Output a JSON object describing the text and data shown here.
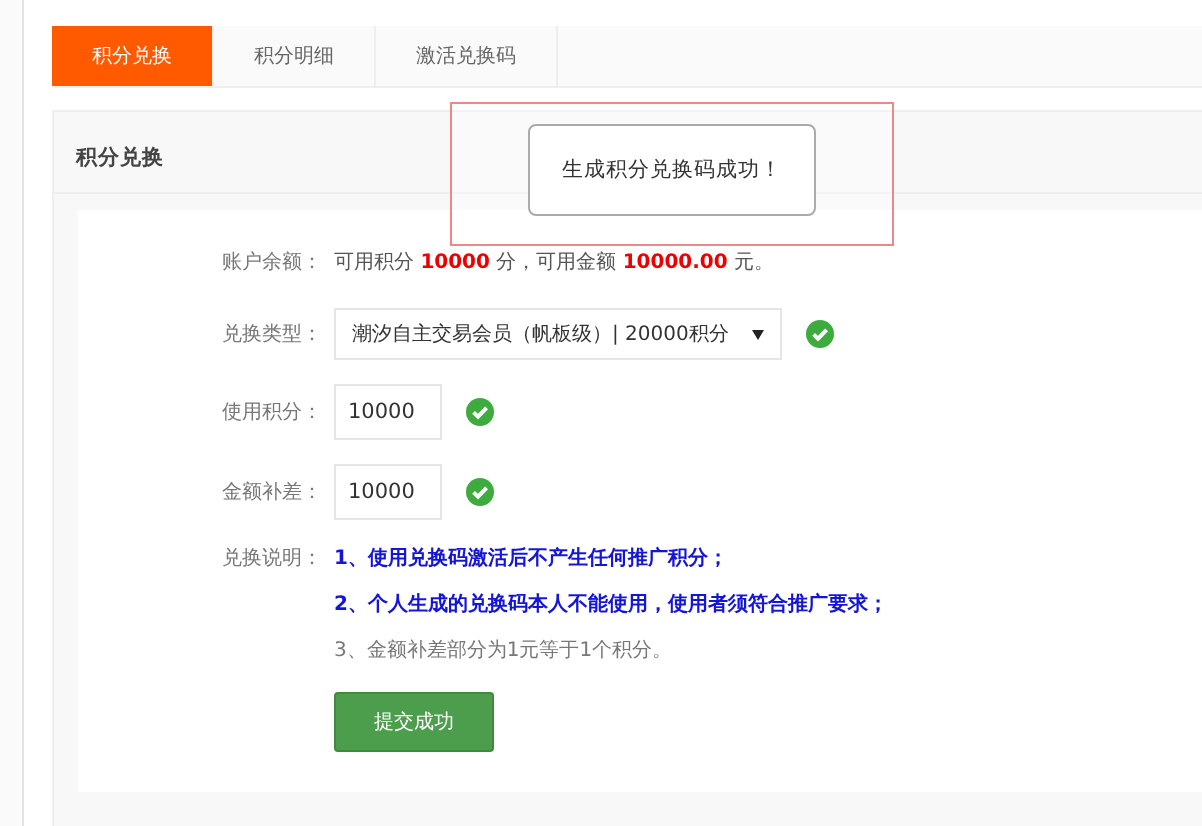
{
  "tabs": [
    {
      "label": "积分兑换",
      "selected": true
    },
    {
      "label": "积分明细",
      "selected": false
    },
    {
      "label": "激活兑换码",
      "selected": false
    }
  ],
  "panel": {
    "title": "积分兑换"
  },
  "balance": {
    "label": "账户余额：",
    "text": "可用积分 **10000** 分，可用金额 **10000.00** 元。"
  },
  "fields": [
    {
      "kind": "select",
      "label": "兑换类型：",
      "value": "潮汐自主交易会员（帆板级）| 20000积分",
      "valid": true
    },
    {
      "kind": "input",
      "label": "使用积分：",
      "value": "10000",
      "valid": true
    },
    {
      "kind": "input",
      "label": "金额补差：",
      "value": "10000",
      "valid": true
    }
  ],
  "notes": {
    "label": "兑换说明：",
    "items": [
      {
        "kind": "emphasis",
        "text": "1、使用兑换码激活后不产生任何推广积分；"
      },
      {
        "kind": "emphasis",
        "text": "2、个人生成的兑换码本人不能使用，使用者须符合推广要求；"
      },
      {
        "kind": "plain",
        "text": "3、金额补差部分为1元等于1个积分。"
      }
    ]
  },
  "submit_button": "提交成功",
  "toast": {
    "message": "生成积分兑换码成功！"
  }
}
